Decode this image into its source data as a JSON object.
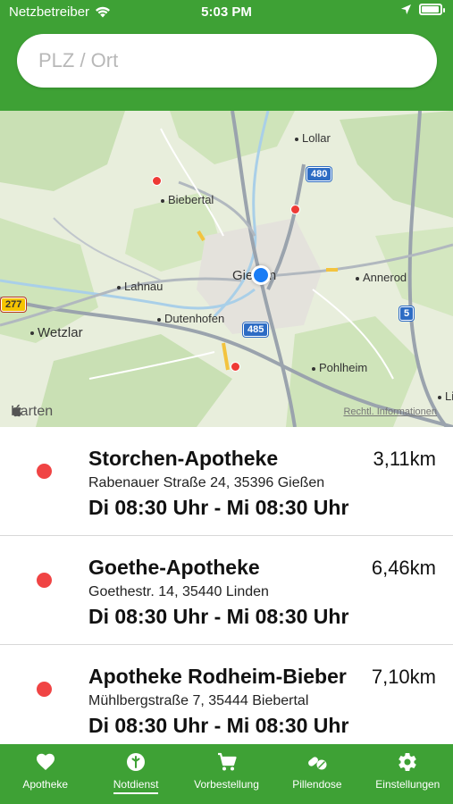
{
  "status_bar": {
    "carrier": "Netzbetreiber",
    "time": "5:03 PM"
  },
  "search": {
    "placeholder": "PLZ / Ort",
    "value": ""
  },
  "map": {
    "places": {
      "lollar": "Lollar",
      "biebertal": "Biebertal",
      "lahnau": "Lahnau",
      "giessen": "Gießen",
      "annerod": "Annerod",
      "dutenhofen": "Dutenhofen",
      "wetzlar": "Wetzlar",
      "pohlheim": "Pohlheim",
      "edge": "Li"
    },
    "road_shields": {
      "a480": "480",
      "a485": "485",
      "a5": "5",
      "b277": "277"
    },
    "brand": "Karten",
    "legal_link": "Rechtl. Informationen",
    "colors": {
      "pin": "#ee3a35",
      "user_location": "#1a7cf5"
    }
  },
  "pharmacies": [
    {
      "name": "Storchen-Apotheke",
      "distance": "3,11km",
      "address": "Rabenauer Straße 24, 35396 Gießen",
      "hours": "Di 08:30 Uhr - Mi 08:30 Uhr"
    },
    {
      "name": "Goethe-Apotheke",
      "distance": "6,46km",
      "address": "Goethestr. 14, 35440 Linden",
      "hours": "Di 08:30 Uhr - Mi 08:30 Uhr"
    },
    {
      "name": "Apotheke Rodheim-Bieber",
      "distance": "7,10km",
      "address": "Mühlbergstraße 7, 35444 Biebertal",
      "hours": "Di 08:30 Uhr - Mi 08:30 Uhr"
    }
  ],
  "tabbar": {
    "active": "Notdienst",
    "tabs": [
      {
        "label": "Apotheke",
        "icon": "heart-icon"
      },
      {
        "label": "Notdienst",
        "icon": "emergency-icon"
      },
      {
        "label": "Vorbestellung",
        "icon": "cart-icon"
      },
      {
        "label": "Pillendose",
        "icon": "pills-icon"
      },
      {
        "label": "Einstellungen",
        "icon": "gear-icon"
      }
    ]
  },
  "colors": {
    "primary_green": "#3ea135",
    "row_marker": "#f04444"
  }
}
